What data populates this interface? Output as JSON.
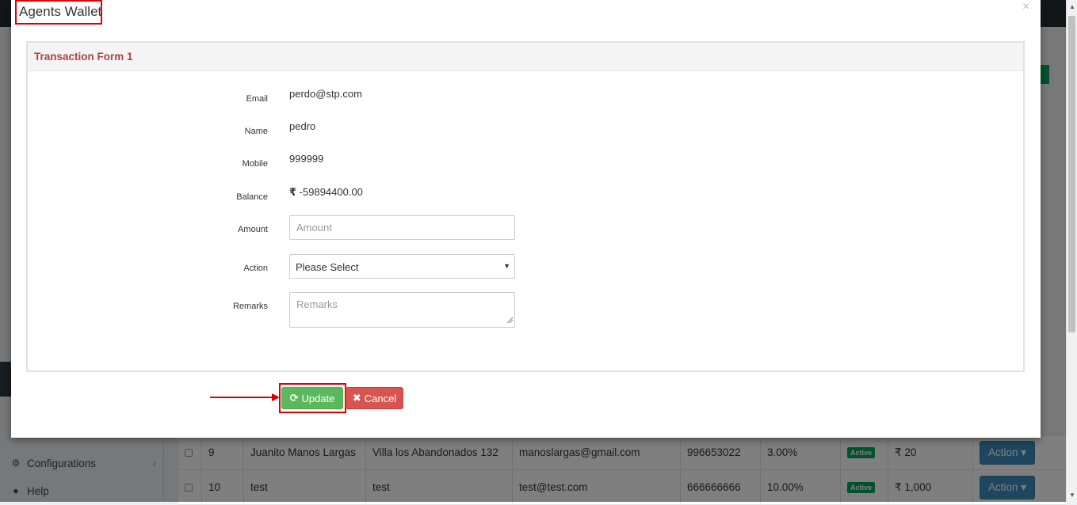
{
  "modal": {
    "title": "Agents Wallet",
    "close_glyph": "×",
    "panel_title": "Transaction Form 1",
    "fields": {
      "email_label": "Email",
      "email_value": "perdo@stp.com",
      "name_label": "Name",
      "name_value": "pedro",
      "mobile_label": "Mobile",
      "mobile_value": "999999",
      "balance_label": "Balance",
      "balance_currency": "₹",
      "balance_value": "-59894400.00",
      "amount_label": "Amount",
      "amount_placeholder": "Amount",
      "action_label": "Action",
      "action_selected": "Please Select",
      "remarks_label": "Remarks",
      "remarks_placeholder": "Remarks"
    },
    "buttons": {
      "update_label": "Update",
      "update_icon": "refresh-icon",
      "cancel_label": "Cancel",
      "cancel_icon": "close-icon"
    },
    "highlight_color": "#e00000"
  },
  "sidebar": {
    "items": [
      {
        "label": "Configurations",
        "icon": "gears-icon"
      },
      {
        "label": "Help",
        "icon": "question-circle-icon"
      }
    ]
  },
  "table": {
    "rows": [
      {
        "id": "9",
        "name": "Juanito Manos Largas",
        "address": "Villa los Abandonados 132",
        "email": "manoslargas@gmail.com",
        "mobile": "996653022",
        "commission": "3.00%",
        "status": "Active",
        "currency": "₹",
        "balance": "20",
        "action": "Action"
      },
      {
        "id": "10",
        "name": "test",
        "address": "test",
        "email": "test@test.com",
        "mobile": "666666666",
        "commission": "10.00%",
        "status": "Active",
        "currency": "₹",
        "balance": "1,000",
        "action": "Action"
      }
    ]
  },
  "colors": {
    "update_button": "#5cb85c",
    "cancel_button": "#d9534f",
    "panel_title": "#a94442",
    "action_button": "#3c8dbc",
    "status_badge": "#00a65a"
  }
}
